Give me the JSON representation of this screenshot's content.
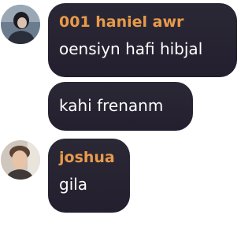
{
  "colors": {
    "bubble_background": "#2b2836",
    "message_text": "#ffffff",
    "sender_name": "#e89a4a"
  },
  "messages": [
    {
      "sender": "001 haniel awr",
      "text": "oensiyn hafi hibjal",
      "avatar": "user-photo-avatar"
    },
    {
      "text": "kahi frenanm"
    },
    {
      "sender": "joshua",
      "text": "gila",
      "avatar": "user-photo-avatar"
    }
  ]
}
